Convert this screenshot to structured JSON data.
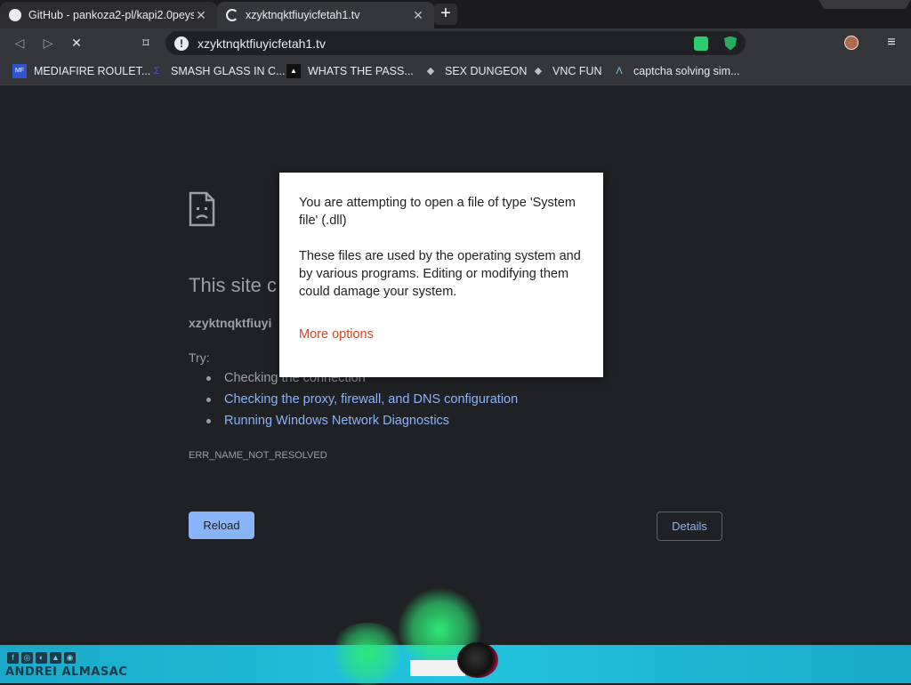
{
  "tabs": [
    {
      "title": "GitHub - pankoza2-pl/kapi2.0peys",
      "icon": "github-icon",
      "close": "✕"
    },
    {
      "title": "xzyktnqktfiuyicfetah1.tv",
      "icon": "loading-spinner-icon",
      "close": "✕"
    }
  ],
  "newtab_symbol": "+",
  "toolbar": {
    "url": "xzyktnqktfiuyicfetah1.tv",
    "back": "◁",
    "forward": "▷",
    "stop": "✕",
    "bookmark": "⌑",
    "menu": "≡"
  },
  "bookmarks": [
    {
      "label": "MEDIAFIRE ROULET...",
      "icon": "mediafire-icon",
      "glyph": "MF",
      "color": "#2f54d1"
    },
    {
      "label": "SMASH GLASS IN C...",
      "icon": "sigma-icon",
      "glyph": "Σ",
      "color": "#5b4bd9"
    },
    {
      "label": "WHATS THE PASS...",
      "icon": "terminal-icon",
      "glyph": "▲",
      "color": "#222222"
    },
    {
      "label": "SEX DUNGEON",
      "icon": "app-icon",
      "glyph": "◆",
      "color": "#6b6b6b"
    },
    {
      "label": "VNC FUN",
      "icon": "app-icon",
      "glyph": "◆",
      "color": "#6b6b6b"
    },
    {
      "label": "captcha solving sim...",
      "icon": "captcha-icon",
      "glyph": "Λ",
      "color": "#35363a"
    }
  ],
  "error_page": {
    "title": "This site c",
    "host": "xzyktnqktfiuyi",
    "try_label": "Try:",
    "suggestions": [
      {
        "text": "Checking the connection",
        "link": false
      },
      {
        "text": "Checking the proxy, firewall, and DNS configuration",
        "link": true
      },
      {
        "text": "Running Windows Network Diagnostics",
        "link": true
      }
    ],
    "error_code": "ERR_NAME_NOT_RESOLVED",
    "reload_label": "Reload",
    "details_label": "Details"
  },
  "dialog": {
    "line1": "You are attempting to open a file of type 'System file' (.dll)",
    "line2": "These files are used by the operating system and by various programs. Editing or modifying them could damage your system.",
    "more_options": "More options"
  },
  "taskbar": {
    "brand": "ANDREI ALMASAC",
    "social_icons": [
      "f",
      "◎",
      "◐",
      "▲",
      "◉"
    ]
  },
  "colors": {
    "background": "#202124",
    "link": "#8ab4f8",
    "accent": "#d24726",
    "taskbar": "#22c4e0"
  }
}
